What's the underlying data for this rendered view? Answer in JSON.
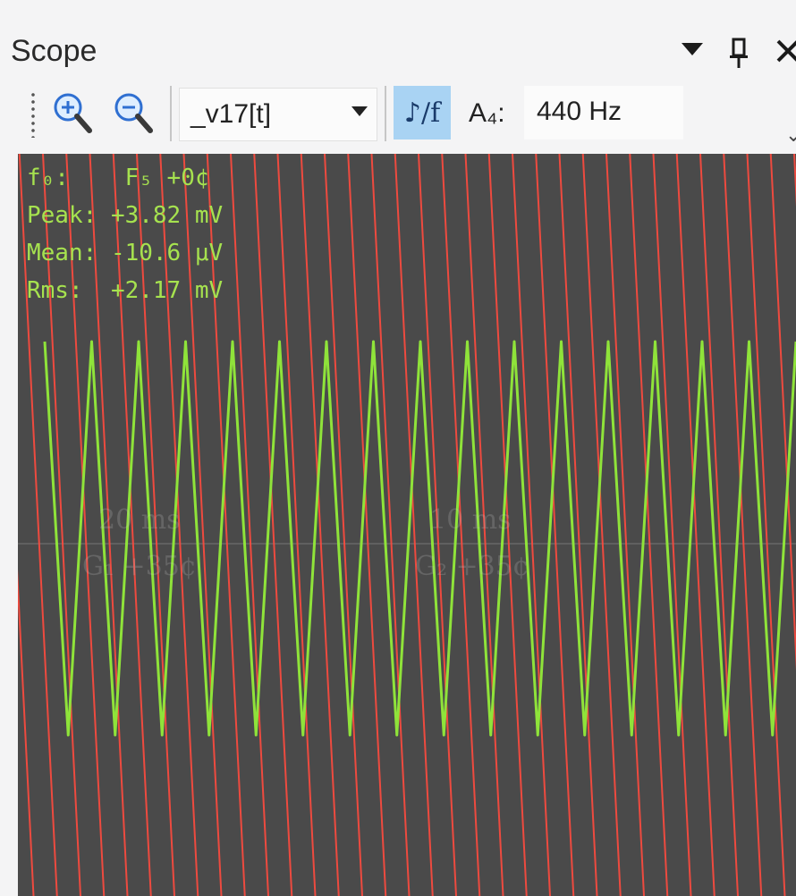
{
  "window": {
    "title": "Scope",
    "icons": [
      "dropdown-triangle-icon",
      "pin-icon",
      "close-icon"
    ]
  },
  "toolbar": {
    "zoom_in_icon": "zoom-in-icon",
    "zoom_out_icon": "zoom-out-icon",
    "signal_select": {
      "selected": "_v17[t]"
    },
    "note_frequency_toggle": {
      "label": "♪/f",
      "active": true
    },
    "reference_label": "A₄:",
    "reference_value": "440 Hz"
  },
  "scope": {
    "background": "#4a4a4a",
    "trace_color": "#8fe33a",
    "marker_color": "#ff4b3e",
    "readouts": [
      {
        "label": "f₀:",
        "value": "F₅ +0¢"
      },
      {
        "label": "Peak:",
        "value": "+3.82 mV"
      },
      {
        "label": "Mean:",
        "value": "-10.6 μV"
      },
      {
        "label": "Rms:",
        "value": "+2.17 mV"
      }
    ],
    "grid_labels": [
      {
        "time": "20 ms",
        "note": "G₁ +35¢"
      },
      {
        "time": "10 ms",
        "note": "G₂ +35¢"
      }
    ],
    "waveform": {
      "shape": "triangle",
      "visible_peaks": 16
    }
  }
}
